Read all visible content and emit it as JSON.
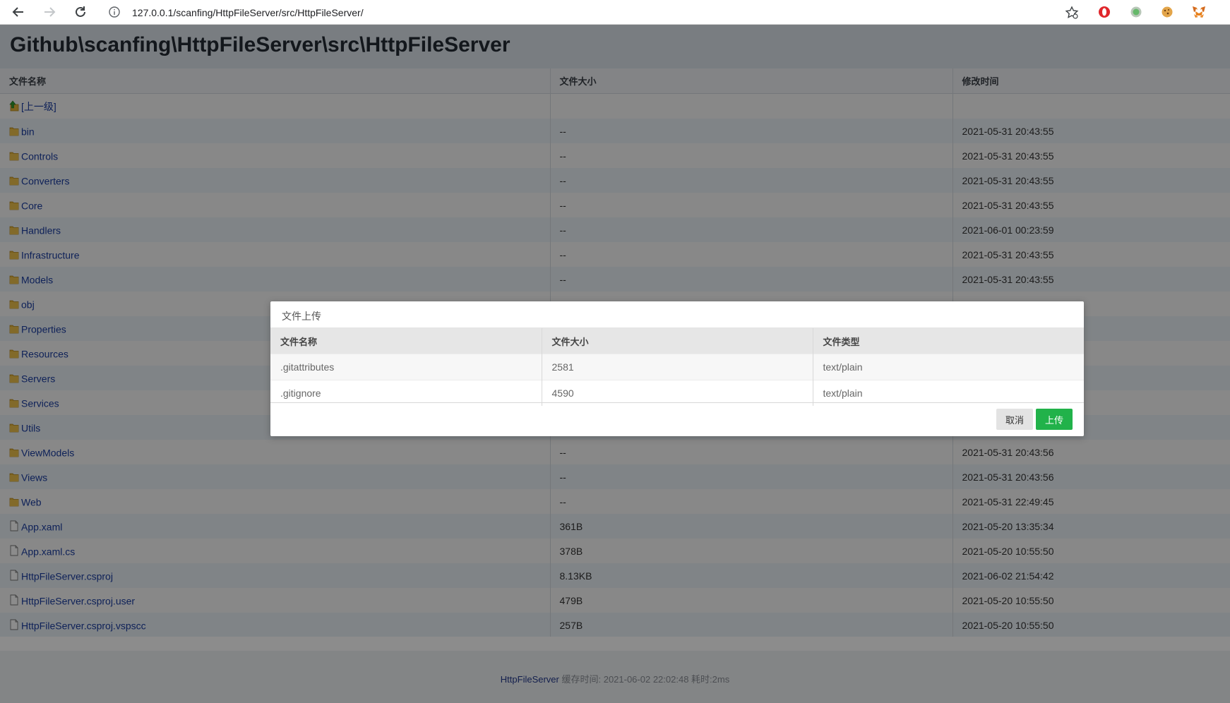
{
  "browser": {
    "url": "127.0.0.1/scanfing/HttpFileServer/src/HttpFileServer/"
  },
  "page": {
    "title": "Github\\scanfing\\HttpFileServer\\src\\HttpFileServer",
    "columns": {
      "name": "文件名称",
      "size": "文件大小",
      "modified": "修改时间"
    },
    "parent_label": "[上一级]",
    "rows": [
      {
        "name": "bin",
        "type": "folder",
        "size": "--",
        "modified": "2021-05-31 20:43:55"
      },
      {
        "name": "Controls",
        "type": "folder",
        "size": "--",
        "modified": "2021-05-31 20:43:55"
      },
      {
        "name": "Converters",
        "type": "folder",
        "size": "--",
        "modified": "2021-05-31 20:43:55"
      },
      {
        "name": "Core",
        "type": "folder",
        "size": "--",
        "modified": "2021-05-31 20:43:55"
      },
      {
        "name": "Handlers",
        "type": "folder",
        "size": "--",
        "modified": "2021-06-01 00:23:59"
      },
      {
        "name": "Infrastructure",
        "type": "folder",
        "size": "--",
        "modified": "2021-05-31 20:43:55"
      },
      {
        "name": "Models",
        "type": "folder",
        "size": "--",
        "modified": "2021-05-31 20:43:55"
      },
      {
        "name": "obj",
        "type": "folder",
        "size": "",
        "modified": ""
      },
      {
        "name": "Properties",
        "type": "folder",
        "size": "",
        "modified": ""
      },
      {
        "name": "Resources",
        "type": "folder",
        "size": "",
        "modified": ""
      },
      {
        "name": "Servers",
        "type": "folder",
        "size": "",
        "modified": ""
      },
      {
        "name": "Services",
        "type": "folder",
        "size": "",
        "modified": ""
      },
      {
        "name": "Utils",
        "type": "folder",
        "size": "",
        "modified": ""
      },
      {
        "name": "ViewModels",
        "type": "folder",
        "size": "--",
        "modified": "2021-05-31 20:43:56"
      },
      {
        "name": "Views",
        "type": "folder",
        "size": "--",
        "modified": "2021-05-31 20:43:56"
      },
      {
        "name": "Web",
        "type": "folder",
        "size": "--",
        "modified": "2021-05-31 22:49:45"
      },
      {
        "name": "App.xaml",
        "type": "file",
        "size": "361B",
        "modified": "2021-05-20 13:35:34"
      },
      {
        "name": "App.xaml.cs",
        "type": "file",
        "size": "378B",
        "modified": "2021-05-20 10:55:50"
      },
      {
        "name": "HttpFileServer.csproj",
        "type": "file",
        "size": "8.13KB",
        "modified": "2021-06-02 21:54:42"
      },
      {
        "name": "HttpFileServer.csproj.user",
        "type": "file",
        "size": "479B",
        "modified": "2021-05-20 10:55:50"
      },
      {
        "name": "HttpFileServer.csproj.vspscc",
        "type": "file",
        "size": "257B",
        "modified": "2021-05-20 10:55:50"
      }
    ],
    "footer": {
      "brand": "HttpFileServer",
      "meta": "缓存时间: 2021-06-02 22:02:48 耗时:2ms"
    }
  },
  "upload_dialog": {
    "title": "文件上传",
    "columns": {
      "name": "文件名称",
      "size": "文件大小",
      "type": "文件类型"
    },
    "files": [
      {
        "name": ".gitattributes",
        "size": "2581",
        "type": "text/plain"
      },
      {
        "name": ".gitignore",
        "size": "4590",
        "type": "text/plain"
      }
    ],
    "cancel_label": "取消",
    "upload_label": "上传"
  },
  "colors": {
    "upload_button": "#21b24a",
    "link": "#1a3da1",
    "folder": "#e2b33a"
  }
}
